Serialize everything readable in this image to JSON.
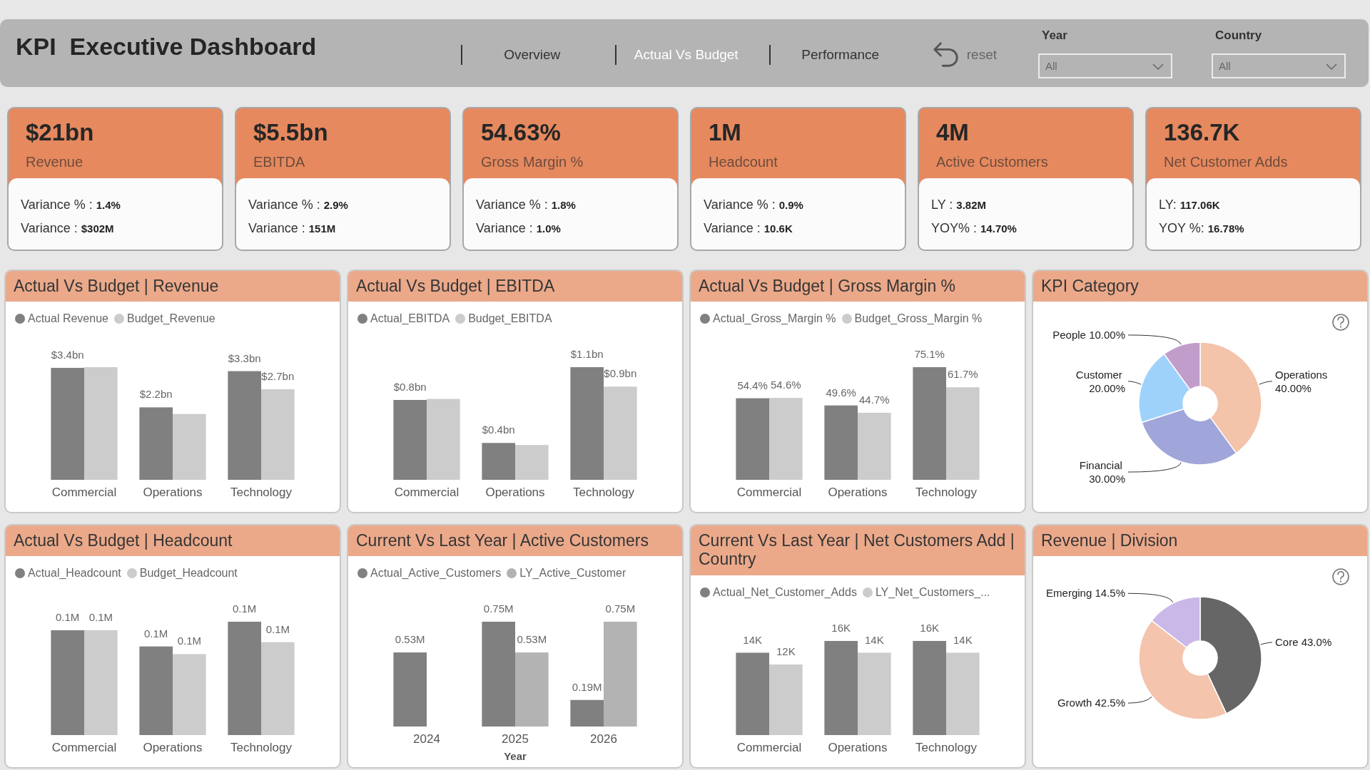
{
  "header": {
    "title": "KPI  Executive Dashboard",
    "tabs": [
      {
        "label": "Overview",
        "selected": false
      },
      {
        "label": "Actual Vs Budget",
        "selected": true
      },
      {
        "label": "Performance",
        "selected": false
      }
    ],
    "reset": {
      "label": "reset"
    },
    "filters": [
      {
        "label": "Year",
        "value": "All"
      },
      {
        "label": "Country",
        "value": "All"
      }
    ]
  },
  "kpi_cards": [
    {
      "value": "$21bn",
      "label": "Revenue",
      "details": [
        "Variance % : **1.4%**",
        "Variance : **$302M**"
      ]
    },
    {
      "value": "$5.5bn",
      "label": "EBITDA",
      "details": [
        "Variance % : **2.9%**",
        "Variance : **151M**"
      ]
    },
    {
      "value": "54.63%",
      "label": "Gross Margin %",
      "details": [
        "Variance % : **1.8%**",
        "Variance : **1.0%**"
      ]
    },
    {
      "value": "1M",
      "label": "Headcount",
      "details": [
        "Variance % : **0.9%**",
        "Variance : **10.6K**"
      ]
    },
    {
      "value": "4M",
      "label": "Active Customers",
      "details": [
        "LY : **3.82M**",
        "YOY% : **14.70%**"
      ]
    },
    {
      "value": "136.7K",
      "label": "Net Customer Adds",
      "details": [
        "LY: **117.06K**",
        "YOY %: **16.78%**"
      ]
    }
  ],
  "charts": [
    {
      "title": "Actual Vs Budget | Revenue",
      "chart_data": {
        "type": "bar",
        "categories": [
          "Commercial",
          "Operations",
          "Technology"
        ],
        "series": [
          {
            "name": "Actual Revenue",
            "color": "#808080",
            "values": [
              3.4,
              2.2,
              3.3
            ],
            "value_labels": [
              "$3.4bn",
              "$2.2bn",
              "$3.3bn"
            ]
          },
          {
            "name": "Budget_Revenue",
            "color": "#cccccc",
            "values": [
              3.42,
              2.0,
              2.75
            ],
            "value_labels": [
              null,
              null,
              "$2.7bn"
            ]
          }
        ]
      }
    },
    {
      "title": "Actual Vs Budget | EBITDA",
      "chart_data": {
        "type": "bar",
        "categories": [
          "Commercial",
          "Operations",
          "Technology"
        ],
        "series": [
          {
            "name": "Actual_EBITDA",
            "color": "#808080",
            "values": [
              0.78,
              0.36,
              1.1
            ],
            "value_labels": [
              "$0.8bn",
              "$0.4bn",
              "$1.1bn"
            ]
          },
          {
            "name": "Budget_EBITDA",
            "color": "#cccccc",
            "values": [
              0.79,
              0.34,
              0.91
            ],
            "value_labels": [
              null,
              null,
              "$0.9bn"
            ]
          }
        ]
      }
    },
    {
      "title": "Actual Vs Budget | Gross Margin %",
      "chart_data": {
        "type": "bar",
        "categories": [
          "Commercial",
          "Operations",
          "Technology"
        ],
        "series": [
          {
            "name": "Actual_Gross_Margin %",
            "color": "#808080",
            "values": [
              54.4,
              49.6,
              75.1
            ],
            "value_labels": [
              "54.4%",
              "49.6%",
              "75.1%"
            ]
          },
          {
            "name": "Budget_Gross_Margin %",
            "color": "#cccccc",
            "values": [
              54.6,
              44.7,
              61.7
            ],
            "value_labels": [
              "54.6%",
              "44.7%",
              "61.7%"
            ]
          }
        ]
      }
    },
    {
      "title": "KPI Category",
      "chart_data": {
        "type": "donut",
        "categories": [
          "Operations",
          "Financial",
          "Customer",
          "People"
        ],
        "values": [
          40,
          30,
          20,
          10
        ],
        "colors": [
          "#f3c3aa",
          "#a0a6d9",
          "#9fd2fb",
          "#c19dcb"
        ],
        "value_labels": [
          "40.00%",
          "30.00%",
          "20.00%",
          "10.00%"
        ]
      }
    },
    {
      "title": "Actual Vs Budget | Headcount",
      "chart_data": {
        "type": "bar",
        "categories": [
          "Commercial",
          "Operations",
          "Technology"
        ],
        "series": [
          {
            "name": "Actual_Headcount",
            "color": "#808080",
            "values": [
              0.123,
              0.104,
              0.133
            ],
            "value_labels": [
              "0.1M",
              "0.1M",
              "0.1M"
            ]
          },
          {
            "name": "Budget_Headcount",
            "color": "#cccccc",
            "values": [
              0.123,
              0.095,
              0.109
            ],
            "value_labels": [
              "0.1M",
              "0.1M",
              "0.1M"
            ]
          }
        ]
      }
    },
    {
      "title": "Current Vs Last Year | Active Customers",
      "chart_data": {
        "type": "bar",
        "xlabel": "Year",
        "categories": [
          "2024",
          "2025",
          "2026"
        ],
        "series": [
          {
            "name": "Actual_Active_Customers",
            "color": "#808080",
            "values": [
              0.53,
              0.75,
              0.19
            ],
            "value_labels": [
              "0.53M",
              "0.75M",
              "0.19M"
            ]
          },
          {
            "name": "LY_Active_Customer",
            "color": "#b3b3b3",
            "values": [
              null,
              0.53,
              0.75
            ],
            "value_labels": [
              null,
              "0.53M",
              "0.75M"
            ]
          }
        ]
      }
    },
    {
      "title": "Current Vs Last Year | Net Customers Add | Country",
      "chart_data": {
        "type": "bar",
        "categories": [
          "Commercial",
          "Operations",
          "Technology"
        ],
        "series": [
          {
            "name": "Actual_Net_Customer_Adds",
            "color": "#808080",
            "values": [
              14,
              16,
              16
            ],
            "value_labels": [
              "14K",
              "16K",
              "16K"
            ]
          },
          {
            "name": "LY_Net_Customers_...",
            "color": "#cccccc",
            "values": [
              12,
              14,
              14
            ],
            "value_labels": [
              "12K",
              "14K",
              "14K"
            ]
          }
        ]
      }
    },
    {
      "title": "Revenue | Division",
      "chart_data": {
        "type": "donut",
        "categories": [
          "Core",
          "Growth",
          "Emerging"
        ],
        "values": [
          43.0,
          42.5,
          14.5
        ],
        "colors": [
          "#666666",
          "#f4c4ad",
          "#c9b8e8"
        ],
        "value_labels": [
          "43.0%",
          "42.5%",
          "14.5%"
        ]
      }
    }
  ]
}
